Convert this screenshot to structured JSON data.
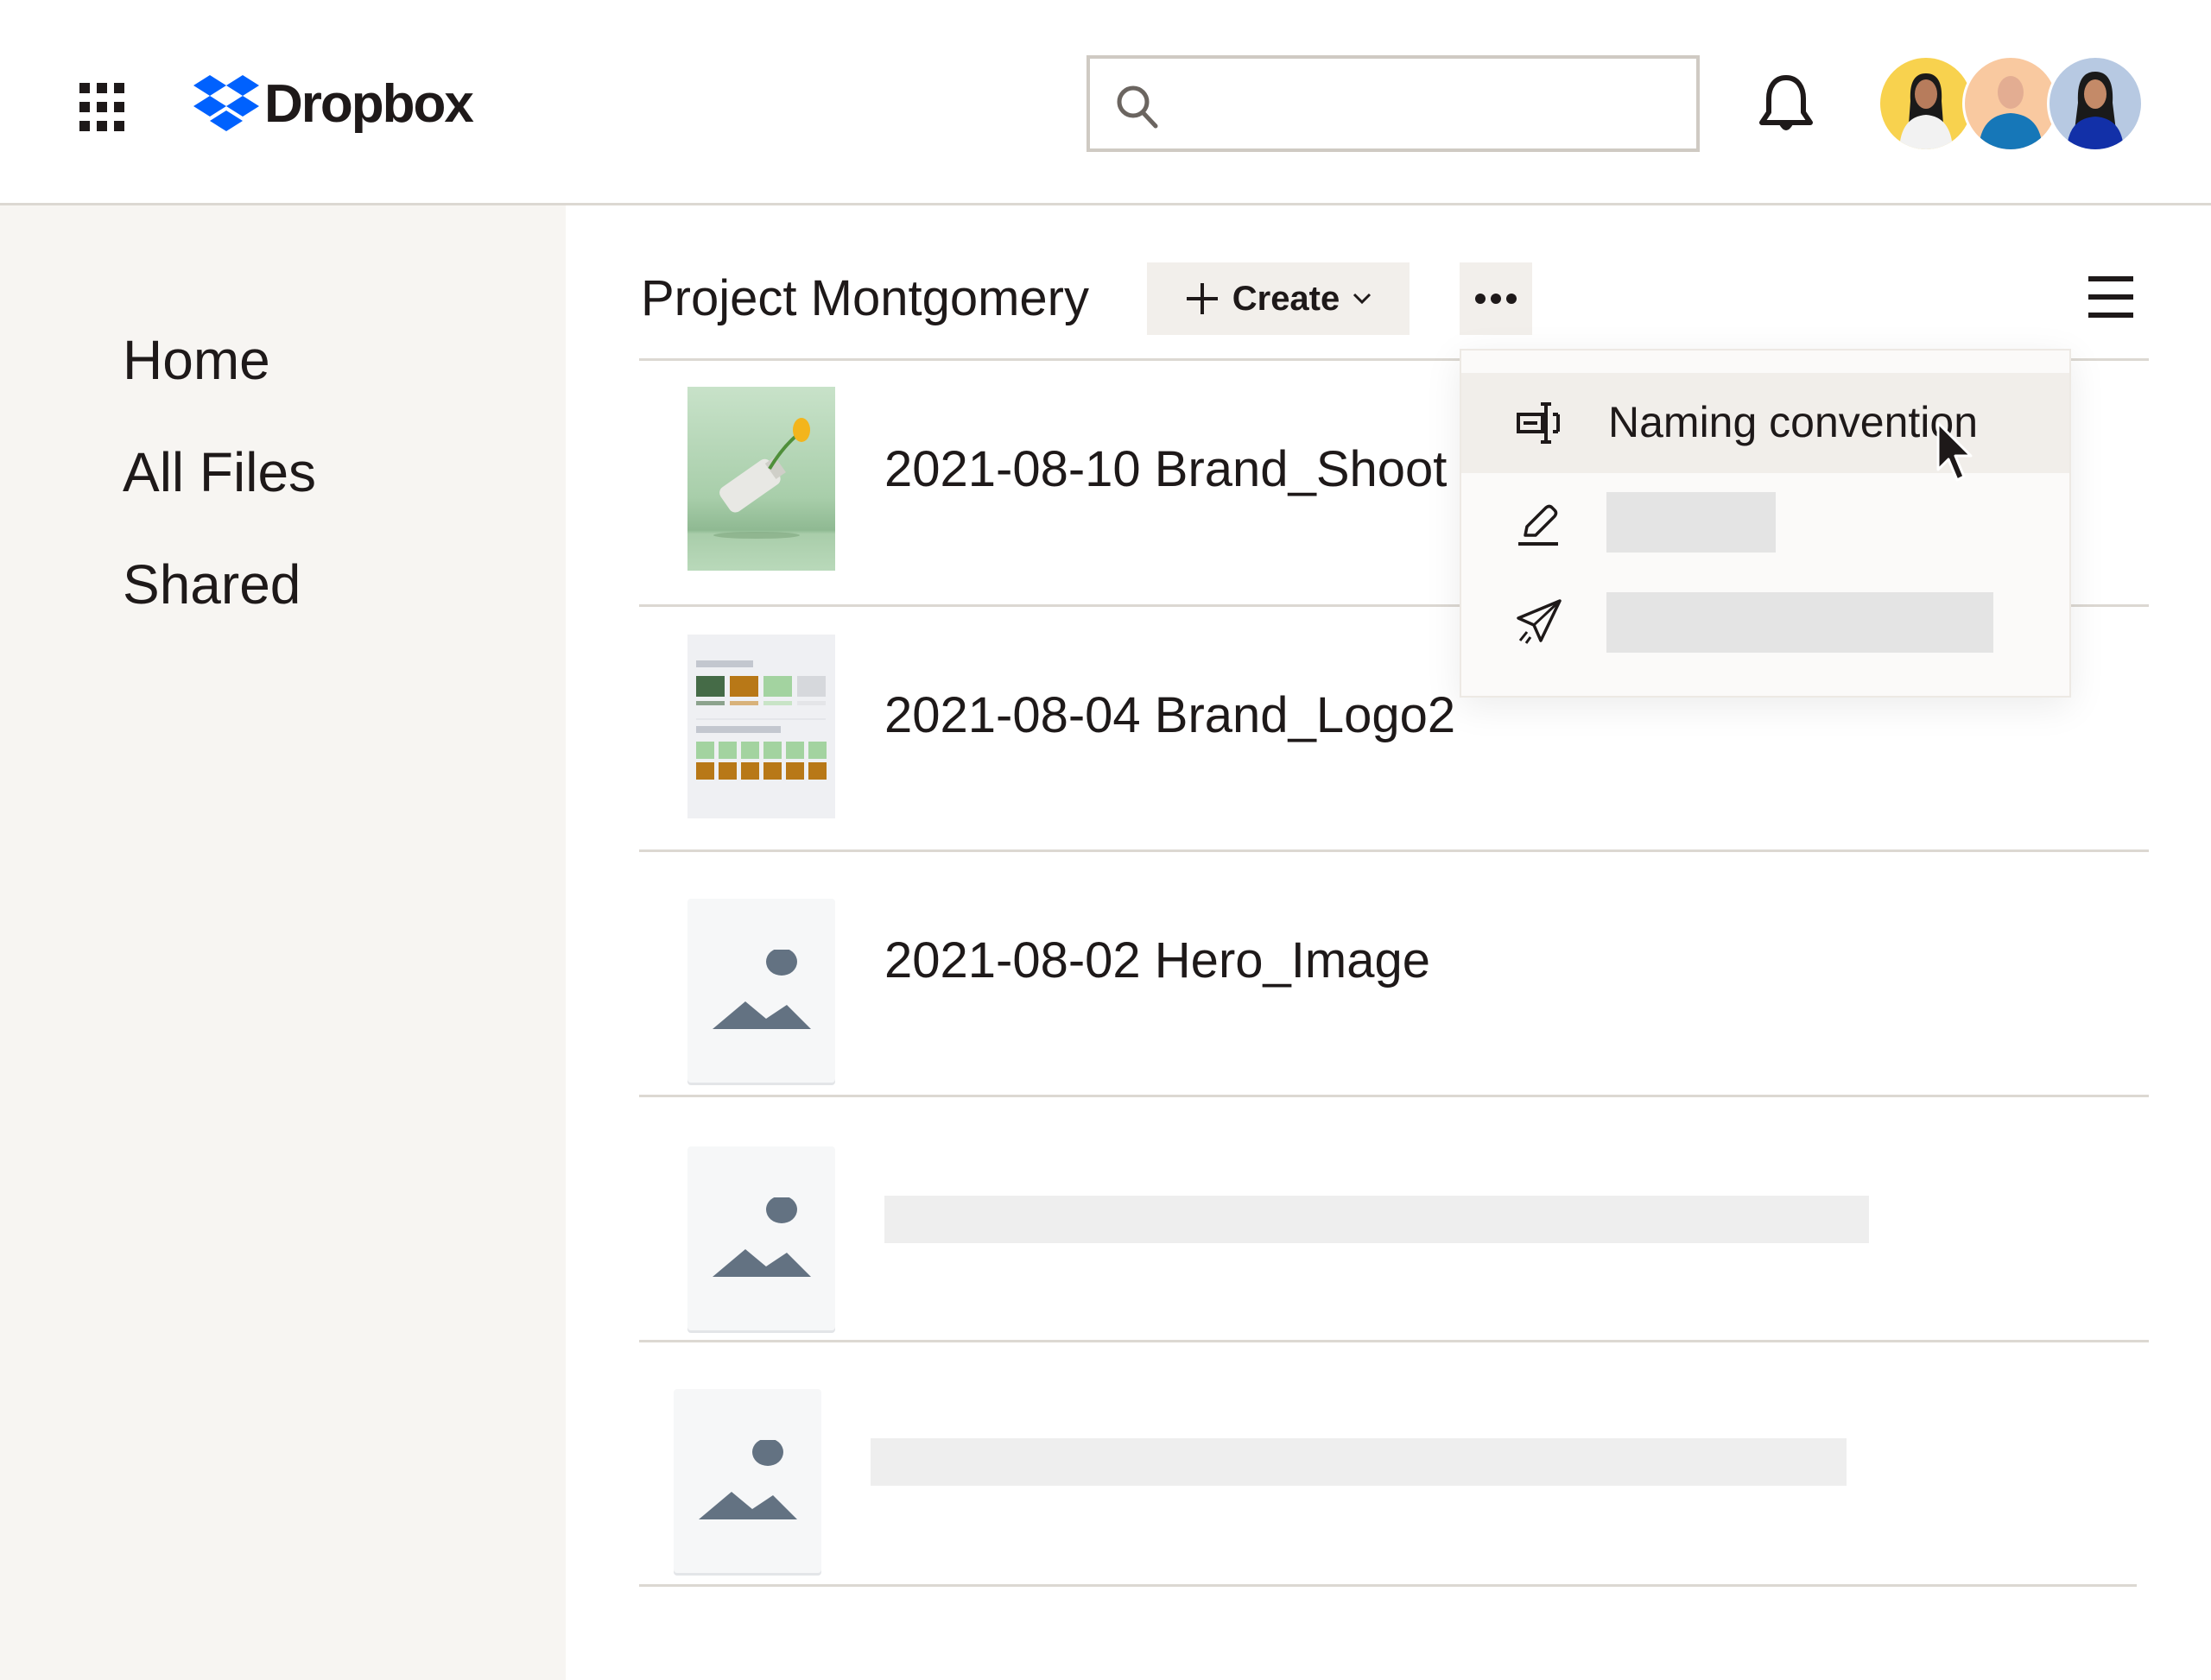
{
  "header": {
    "app_launcher_icon": "grid-icon",
    "logo_text": "Dropbox",
    "logo_color": "#0061fe",
    "search": {
      "value": "",
      "placeholder": ""
    },
    "notifications_icon": "bell-icon",
    "avatars": [
      {
        "name": "avatar-1",
        "bg": "#f8d24e",
        "shirt": "#f2f2f2",
        "hair": "#1a1a1a"
      },
      {
        "name": "avatar-2",
        "bg": "#f9c9a0",
        "shirt": "#1677b8",
        "hair": "#d9a98c"
      },
      {
        "name": "avatar-3",
        "bg": "#b7c9e2",
        "shirt": "#1230a8",
        "hair": "#1a1a1a"
      }
    ]
  },
  "sidebar": {
    "items": [
      {
        "label": "Home"
      },
      {
        "label": "All Files"
      },
      {
        "label": "Shared"
      }
    ]
  },
  "toolbar": {
    "folder_title": "Project Montgomery",
    "create_label": "Create",
    "more_icon": "ellipsis-icon",
    "view_icon": "hamburger-icon"
  },
  "files": [
    {
      "name": "2021-08-10 Brand_Shoot",
      "thumbnail": "photo"
    },
    {
      "name": "2021-08-04 Brand_Logo2",
      "thumbnail": "brand-guide"
    },
    {
      "name": "2021-08-02 Hero_Image",
      "thumbnail": "image-placeholder"
    },
    {
      "name": "",
      "thumbnail": "image-placeholder",
      "loading": true
    },
    {
      "name": "",
      "thumbnail": "image-placeholder",
      "loading": true
    }
  ],
  "dropdown": {
    "items": [
      {
        "label": "Naming convention",
        "icon": "rename-icon",
        "highlighted": true
      },
      {
        "label": "",
        "icon": "pencil-icon",
        "loading": true
      },
      {
        "label": "",
        "icon": "send-icon",
        "loading": true
      }
    ]
  },
  "colors": {
    "text": "#1e1919",
    "sidebar_bg": "#f7f5f2",
    "button_bg": "#f2efeb",
    "placeholder_icon": "#637282"
  }
}
